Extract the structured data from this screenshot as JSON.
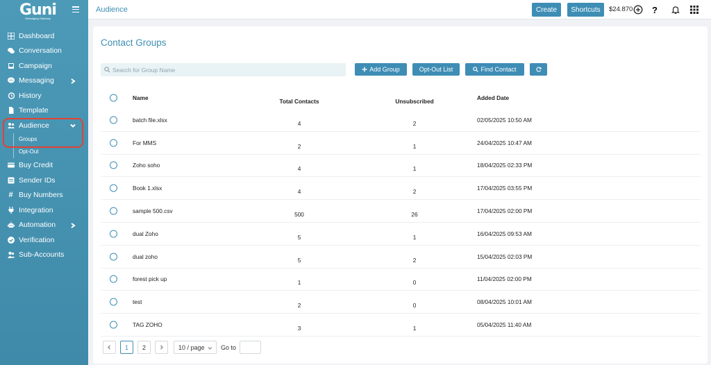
{
  "app": {
    "logo_text": "Guni",
    "logo_subtext": "Messaging Gateway"
  },
  "sidebar": {
    "items": [
      {
        "label": "Dashboard",
        "icon": "dashboard-icon"
      },
      {
        "label": "Conversation",
        "icon": "chat-icon"
      },
      {
        "label": "Campaign",
        "icon": "inbox-icon"
      },
      {
        "label": "Messaging",
        "icon": "message-icon"
      },
      {
        "label": "History",
        "icon": "history-icon"
      },
      {
        "label": "Template",
        "icon": "file-icon"
      },
      {
        "label": "Audience",
        "icon": "users-icon"
      },
      {
        "label": "Buy Credit",
        "icon": "credit-card-icon"
      },
      {
        "label": "Sender IDs",
        "icon": "id-card-icon"
      },
      {
        "label": "Buy Numbers",
        "icon": "hash-icon"
      },
      {
        "label": "Integration",
        "icon": "plug-icon"
      },
      {
        "label": "Automation",
        "icon": "robot-icon"
      },
      {
        "label": "Verification",
        "icon": "check-circle-icon"
      },
      {
        "label": "Sub-Accounts",
        "icon": "user-group-icon"
      }
    ],
    "audience_sub": [
      "Groups",
      "Opt-Out"
    ]
  },
  "topbar": {
    "title": "Audience",
    "create_label": "Create",
    "shortcuts_label": "Shortcuts",
    "balance": "$24.870"
  },
  "page": {
    "title": "Contact Groups",
    "search_placeholder": "Search for Group Name",
    "add_group_label": "Add Group",
    "optout_label": "Opt-Out List",
    "find_contact_label": "Find Contact"
  },
  "table": {
    "headers": [
      "Name",
      "Total Contacts",
      "Unsubscribed",
      "Added Date"
    ],
    "rows": [
      {
        "name": "batch file.xlsx",
        "total": "4",
        "unsub": "2",
        "date": "02/05/2025 10:50 AM"
      },
      {
        "name": "For MMS",
        "total": "2",
        "unsub": "1",
        "date": "24/04/2025 10:47 AM"
      },
      {
        "name": "Zoho soho",
        "total": "4",
        "unsub": "1",
        "date": "18/04/2025 02:33 PM"
      },
      {
        "name": "Book 1.xlsx",
        "total": "4",
        "unsub": "2",
        "date": "17/04/2025 03:55 PM"
      },
      {
        "name": "sample 500.csv",
        "total": "500",
        "unsub": "26",
        "date": "17/04/2025 02:00 PM"
      },
      {
        "name": "dual Zoho",
        "total": "5",
        "unsub": "1",
        "date": "16/04/2025 09:53 AM"
      },
      {
        "name": "dual zoho",
        "total": "5",
        "unsub": "2",
        "date": "15/04/2025 02:03 PM"
      },
      {
        "name": "forest pick up",
        "total": "1",
        "unsub": "0",
        "date": "11/04/2025 02:00 PM"
      },
      {
        "name": "test",
        "total": "2",
        "unsub": "0",
        "date": "08/04/2025 10:01 AM"
      },
      {
        "name": "TAG ZOHO",
        "total": "3",
        "unsub": "1",
        "date": "05/04/2025 11:40 AM"
      }
    ]
  },
  "pagination": {
    "pages": [
      "1",
      "2"
    ],
    "current": "1",
    "page_size": "10 / page",
    "goto_label": "Go to"
  },
  "colors": {
    "accent": "#3e8db5",
    "highlight": "#e64031"
  }
}
